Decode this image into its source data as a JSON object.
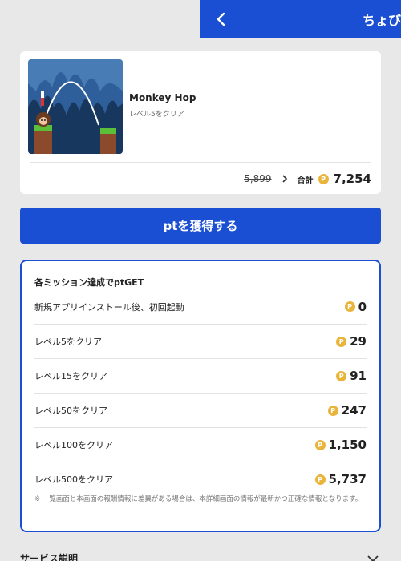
{
  "header": {
    "title": "ちょび"
  },
  "game": {
    "name": "Monkey Hop",
    "subtitle": "レベル5をクリア",
    "old_points": "5,899",
    "total_label": "合計",
    "total_points": "7,254"
  },
  "cta": {
    "label": "ptを獲得する"
  },
  "missions": {
    "title": "各ミッション達成でptGET",
    "items": [
      {
        "label": "新規アプリインストール後、初回起動",
        "points": "0"
      },
      {
        "label": "レベル5をクリア",
        "points": "29"
      },
      {
        "label": "レベル15をクリア",
        "points": "91"
      },
      {
        "label": "レベル50をクリア",
        "points": "247"
      },
      {
        "label": "レベル100をクリア",
        "points": "1,150"
      },
      {
        "label": "レベル500をクリア",
        "points": "5,737"
      }
    ],
    "note": "※ 一覧画面と本画面の報酬情報に差異がある場合は、本詳細画面の情報が最新かつ正確な情報となります。"
  },
  "service": {
    "label": "サービス説明"
  },
  "coin_glyph": "P",
  "colors": {
    "brand": "#1a4fd3",
    "coin": "#e9b43a",
    "background": "#e8e8e8"
  }
}
